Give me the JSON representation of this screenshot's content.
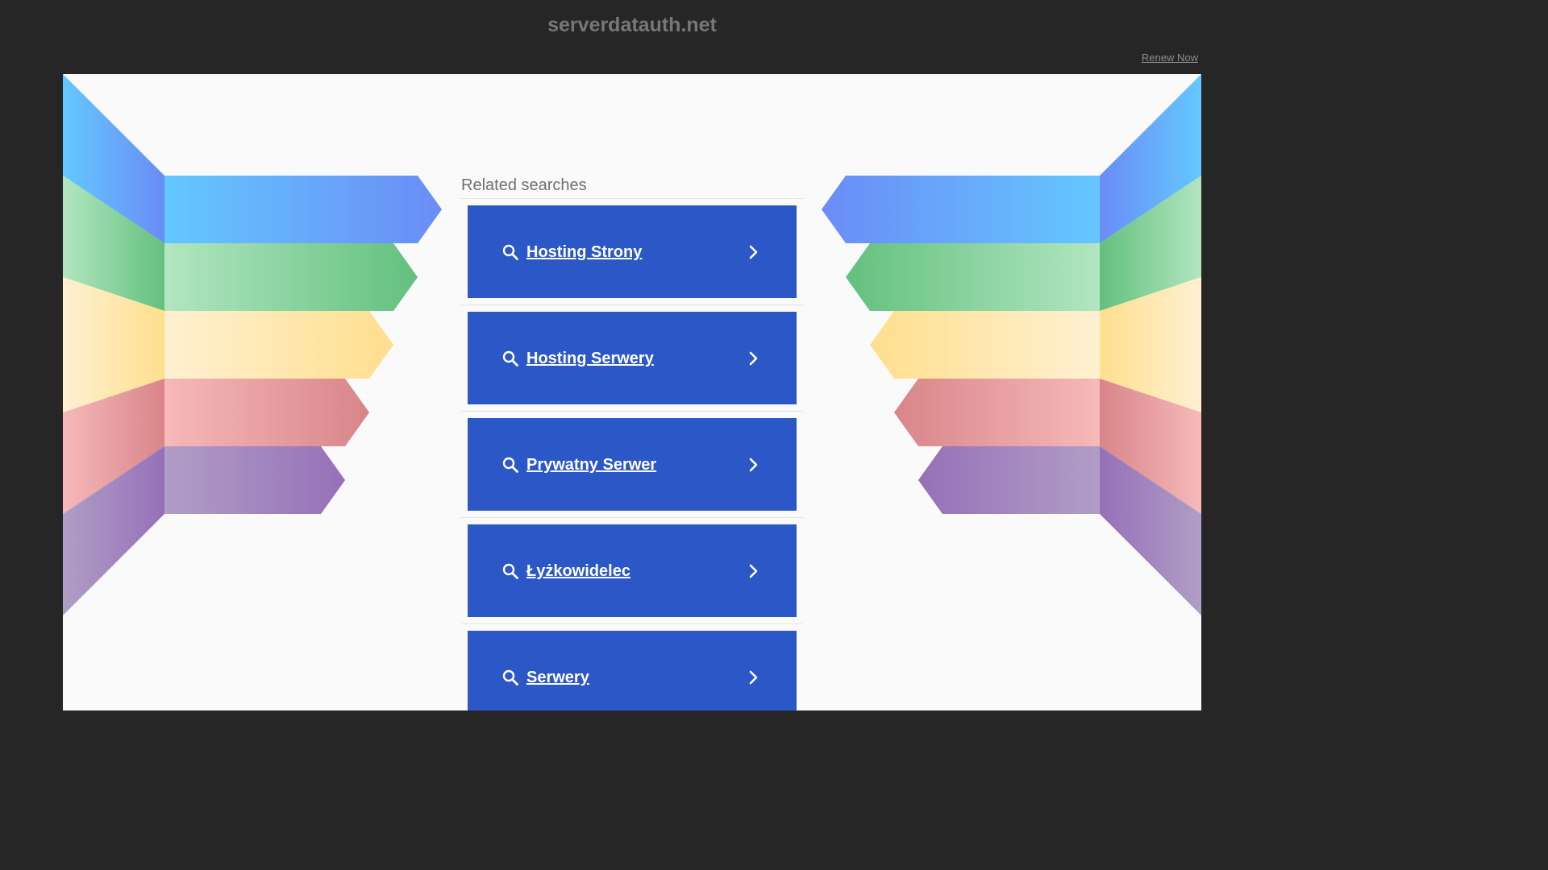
{
  "header": {
    "domain": "serverdatauth.net",
    "renew_label": "Renew Now"
  },
  "related": {
    "title": "Related searches",
    "items": [
      {
        "label": "Hosting Strony",
        "icon": "search-icon",
        "arrow": "chevron-right-icon"
      },
      {
        "label": "Hosting Serwery",
        "icon": "search-icon",
        "arrow": "chevron-right-icon"
      },
      {
        "label": "Prywatny Serwer",
        "icon": "search-icon",
        "arrow": "chevron-right-icon"
      },
      {
        "label": "Łyżkowidelec",
        "icon": "search-icon",
        "arrow": "chevron-right-icon"
      },
      {
        "label": "Serwery",
        "icon": "search-icon",
        "arrow": "chevron-right-icon"
      }
    ]
  },
  "colors": {
    "page_bg": "#262626",
    "panel_bg": "#fafafa",
    "button_bg": "#2c57c6",
    "ribbon_blue": "#64b5f6",
    "ribbon_green": "#66bb6a",
    "ribbon_yellow": "#ffe082",
    "ribbon_red": "#e57373",
    "ribbon_purple": "#9575cd"
  }
}
